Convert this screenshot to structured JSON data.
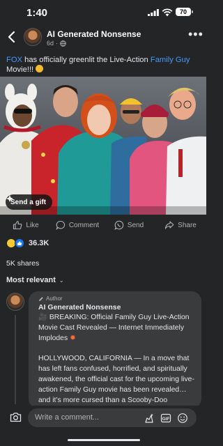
{
  "status": {
    "time": "1:40",
    "battery": "70"
  },
  "header": {
    "page_name": "AI Generated Nonsense",
    "age": "6d"
  },
  "post": {
    "caption_link1": "FOX",
    "caption_part1": " has officially greenlit the Live-Action ",
    "caption_link2": "Family Guy",
    "caption_part2": " Movie!!! "
  },
  "photo": {
    "gift_label": "Send a gift"
  },
  "actions": {
    "like": "Like",
    "comment": "Comment",
    "send": "Send",
    "share": "Share"
  },
  "stats": {
    "reactions": "36.3K",
    "shares": "5K shares"
  },
  "comments": {
    "sort_label": "Most relevant",
    "author_badge": "Author",
    "name": "AI Generated Nonsense",
    "paragraph1": "BREAKING: Official Family Guy Live-Action Movie Cast Revealed — Internet Immediately Implodes",
    "paragraph2": "HOLLYWOOD, CALIFORNIA — In a move that has left fans confused, horrified, and spiritually awakened, the official cast for the upcoming live-action Family Guy movie has been revealed… and it’s more cursed than a Scooby-Doo crossover with the Kardashians."
  },
  "composer": {
    "placeholder": "Write a comment..."
  },
  "colors": {
    "link": "#4599ff",
    "background": "#242526",
    "bubble": "#3a3b3c",
    "like_blue": "#1877f2"
  }
}
